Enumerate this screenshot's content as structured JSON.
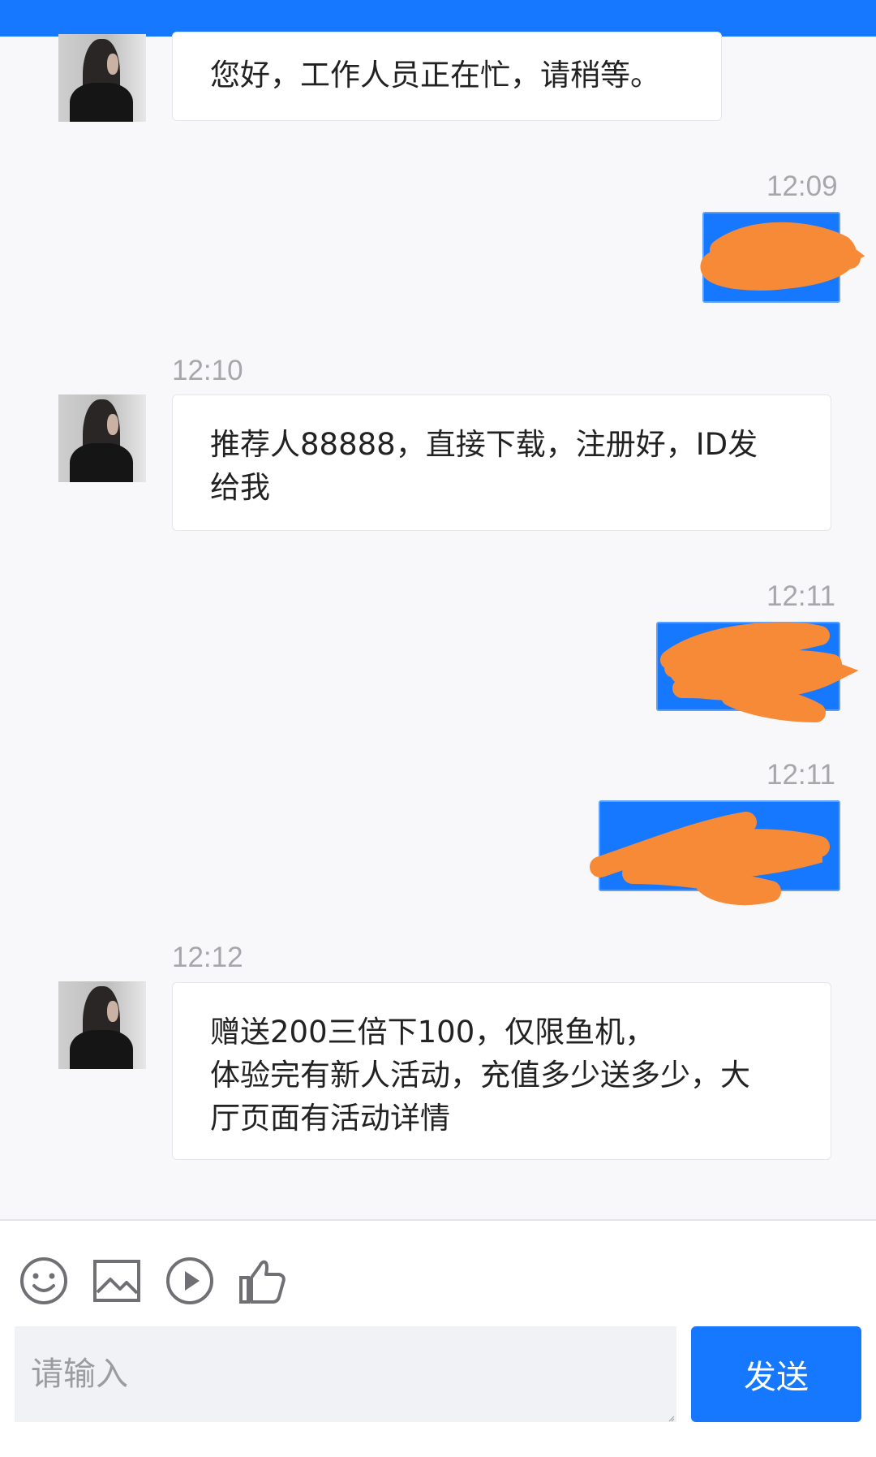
{
  "messages": [
    {
      "direction": "incoming",
      "lines": [
        "您好，工作人员正在忙，请稍等。"
      ]
    },
    {
      "direction": "outgoing",
      "time": "12:09",
      "content": "redacted"
    },
    {
      "direction": "incoming",
      "time": "12:10",
      "lines": [
        "推荐人88888，直接下载，注册好，ID发",
        "给我"
      ]
    },
    {
      "direction": "outgoing",
      "time": "12:11",
      "content": "redacted"
    },
    {
      "direction": "outgoing",
      "time": "12:11",
      "content": "redacted"
    },
    {
      "direction": "incoming",
      "time": "12:12",
      "lines": [
        "赠送200三倍下100，仅限鱼机，",
        "体验完有新人活动，充值多少送多少，大",
        "厅页面有活动详情"
      ]
    }
  ],
  "toolbar": {
    "icons": [
      "emoji-icon",
      "image-icon",
      "video-icon",
      "thumbs-up-icon"
    ]
  },
  "composer": {
    "placeholder": "请输入",
    "send_label": "发送"
  },
  "colors": {
    "accent": "#1677ff",
    "redaction": "#f78a36",
    "background": "#f8f8fa"
  }
}
